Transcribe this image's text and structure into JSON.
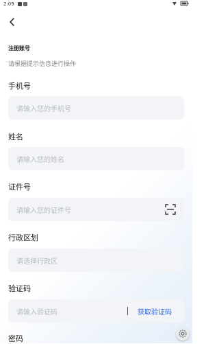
{
  "status_bar": {
    "time": "2:09"
  },
  "form": {
    "title": "注册账号",
    "subtitle": "请根据提示信息进行操作",
    "phone_label": "手机号",
    "phone_placeholder": "请输入您的手机号",
    "name_label": "姓名",
    "name_placeholder": "请输入您的姓名",
    "id_label": "证件号",
    "id_placeholder": "请输入您的证件号",
    "region_label": "行政区划",
    "region_placeholder": "请选择行政区",
    "code_label": "验证码",
    "code_placeholder": "请输入验证码",
    "get_code_label": "获取验证码",
    "password_label": "密码"
  },
  "colors": {
    "accent": "#2f6bdc",
    "input_bg": "#f3f4f7",
    "placeholder": "#b8bcc4"
  },
  "icons": [
    "back-arrow-icon",
    "scan-icon",
    "settings-icon",
    "wifi-icon",
    "battery-icon"
  ]
}
